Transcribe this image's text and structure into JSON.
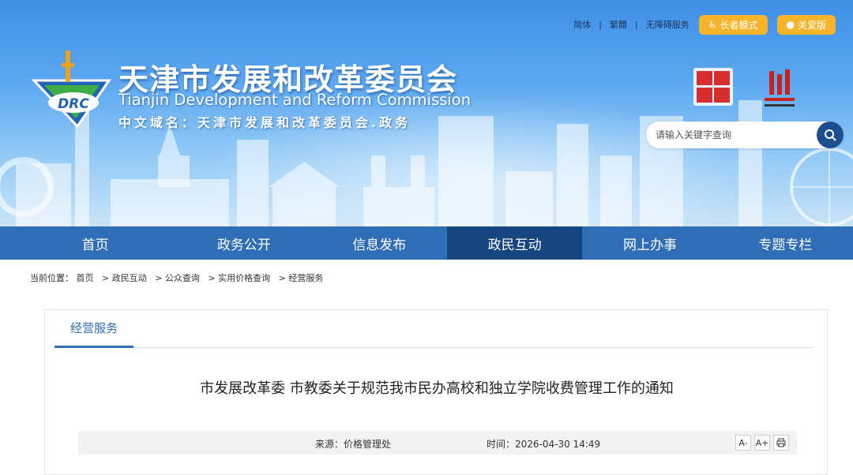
{
  "topbar": {
    "links": [
      "简体",
      "繁體",
      "无障碍服务"
    ],
    "separator": "|",
    "elder_mode": "长者模式",
    "care_mode": "关爱版"
  },
  "header": {
    "title": "天津市发展和改革委员会",
    "subtitle": "Tianjin Development and Reform Commission",
    "domain": "中文域名：天津市发展和改革委员会.政务",
    "logo_text": "DRC",
    "accent_color": "#f5b42a"
  },
  "search": {
    "placeholder": "请输入关键字查询"
  },
  "nav": {
    "items": [
      "首页",
      "政务公开",
      "信息发布",
      "政民互动",
      "网上办事",
      "专题专栏"
    ],
    "active": "政民互动",
    "bar_color": "#2f6eb6",
    "active_color": "#17457f"
  },
  "breadcrumb": {
    "label": "当前位置：",
    "items": [
      "首页",
      "政民互动",
      "公众查询",
      "实用价格查询",
      "经营服务"
    ],
    "separator": ">"
  },
  "panel": {
    "tab": "经营服务",
    "article_title": "市发展改革委 市教委关于规范我市民办高校和独立学院收费管理工作的通知",
    "source": "来源：价格管理处",
    "time": "时间：2026-04-30 14:49",
    "tools": [
      "A-",
      "A+",
      "print-icon"
    ]
  }
}
